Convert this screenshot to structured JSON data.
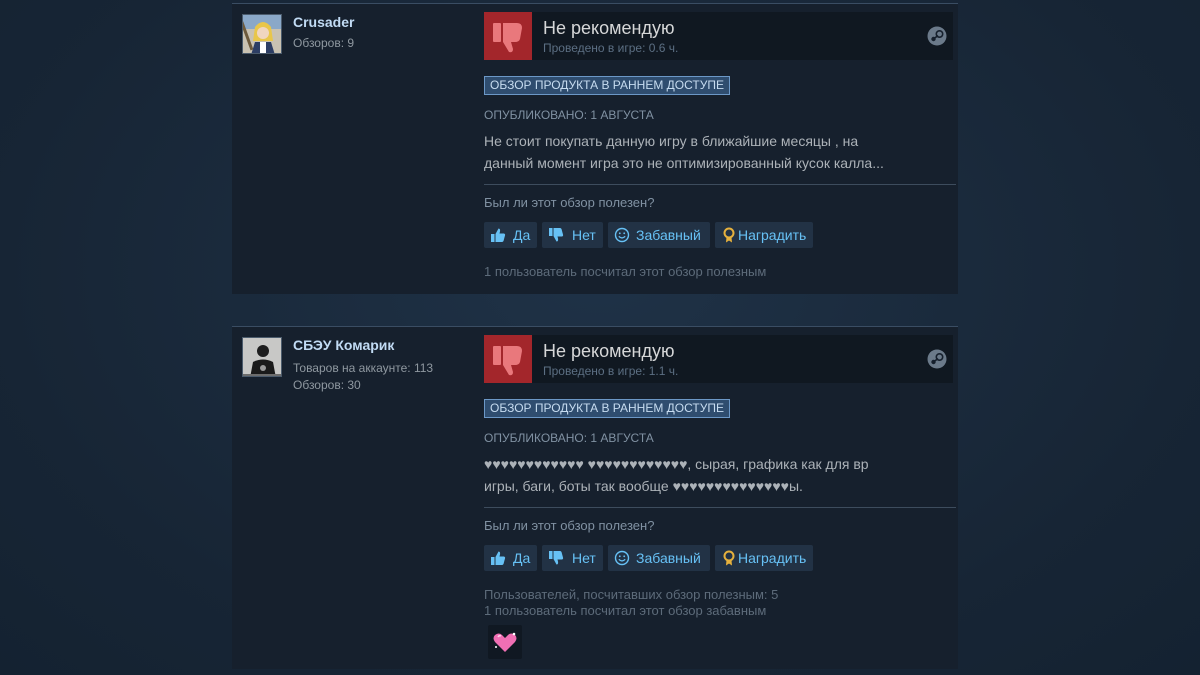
{
  "reviews": [
    {
      "author": {
        "name": "Crusader",
        "lines": [
          "Обзоров: 9"
        ]
      },
      "vote": {
        "title": "Не рекомендую",
        "hours": "Проведено в игре: 0.6 ч."
      },
      "badge": "ОБЗОР ПРОДУКТА В РАННЕМ ДОСТУПЕ",
      "posted": "ОПУБЛИКОВАНО: 1 АВГУСТА",
      "body": [
        "Не стоит покупать данную игру в ближайшие месяцы , на",
        "данный момент игра это не оптимизированный кусок калла..."
      ],
      "helpful_question": "Был ли этот обзор полезен?",
      "buttons": {
        "yes": "Да",
        "no": "Нет",
        "funny": "Забавный",
        "award": "Наградить"
      },
      "stats": [
        "1 пользователь посчитал этот обзор полезным"
      ]
    },
    {
      "author": {
        "name": "СБЭУ Комарик",
        "lines": [
          "Товаров на аккаунте: 113",
          "Обзоров: 30"
        ]
      },
      "vote": {
        "title": "Не рекомендую",
        "hours": "Проведено в игре: 1.1 ч."
      },
      "badge": "ОБЗОР ПРОДУКТА В РАННЕМ ДОСТУПЕ",
      "posted": "ОПУБЛИКОВАНО: 1 АВГУСТА",
      "body": [
        "♥♥♥♥♥♥♥♥♥♥♥♥ ♥♥♥♥♥♥♥♥♥♥♥♥, сырая, графика как для вр",
        "игры, баги, боты так вообще ♥♥♥♥♥♥♥♥♥♥♥♥♥♥ы."
      ],
      "helpful_question": "Был ли этот обзор полезен?",
      "buttons": {
        "yes": "Да",
        "no": "Нет",
        "funny": "Забавный",
        "award": "Наградить"
      },
      "stats": [
        "Пользователей, посчитавших обзор полезным: 5",
        "1 пользователь посчитал этот обзор забавным"
      ],
      "award_icon": "heart-award-icon"
    }
  ],
  "colors": {
    "background": "#1b2838",
    "card": "#16202d",
    "thumb_down_bg": "#a3262b",
    "link_blue": "#67c1f5",
    "award_gold": "#e6b13d"
  }
}
